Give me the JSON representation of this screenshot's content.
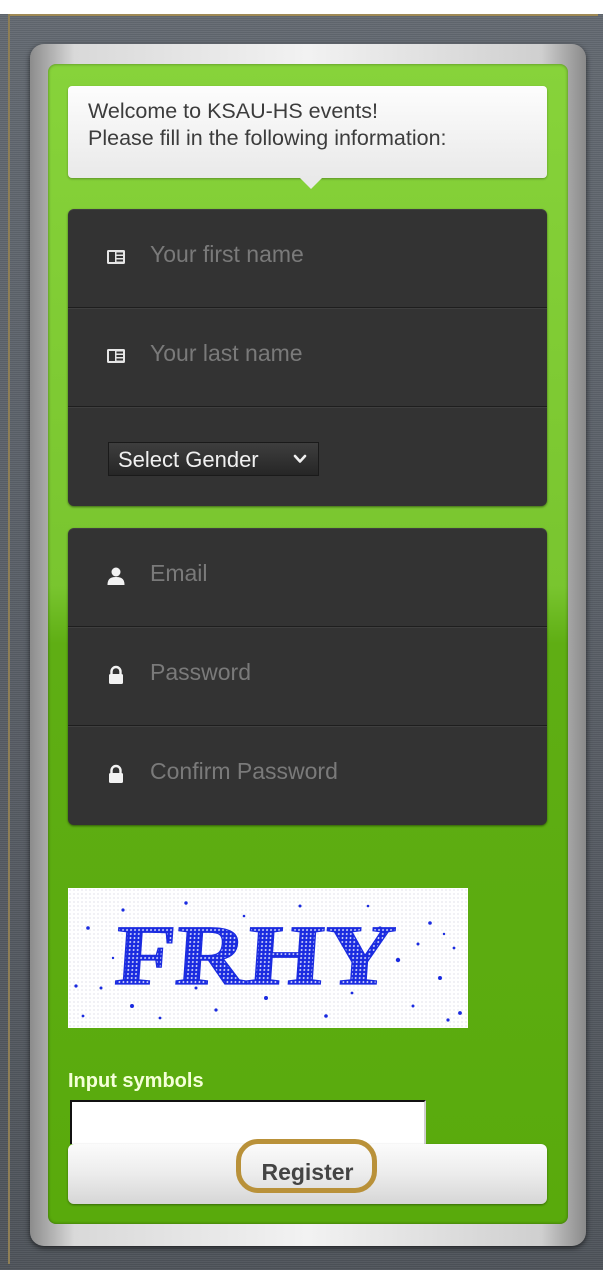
{
  "form": {
    "welcome_line1": "Welcome to KSAU-HS events!",
    "welcome_line2": "Please fill in the following information:",
    "first_name_placeholder": "Your first name",
    "last_name_placeholder": "Your last name",
    "gender_selected": "Select Gender",
    "email_placeholder": "Email",
    "password_placeholder": "Password",
    "confirm_password_placeholder": "Confirm Password",
    "captcha_text": "FRHY",
    "captcha_label": "Input symbols",
    "captcha_input_value": "",
    "register_label": "Register"
  },
  "icons": {
    "name_field": "id-card-icon",
    "gender_select": "chevron-down-icon",
    "email_field": "user-icon",
    "password_field": "lock-icon",
    "confirm_password_field": "lock-icon"
  },
  "colors": {
    "panel_green": "#6bbd1f",
    "input_panel": "#333333",
    "captcha_glyph": "#1d2ee0",
    "register_highlight": "#b99139",
    "label_text": "#f4ffd8"
  }
}
